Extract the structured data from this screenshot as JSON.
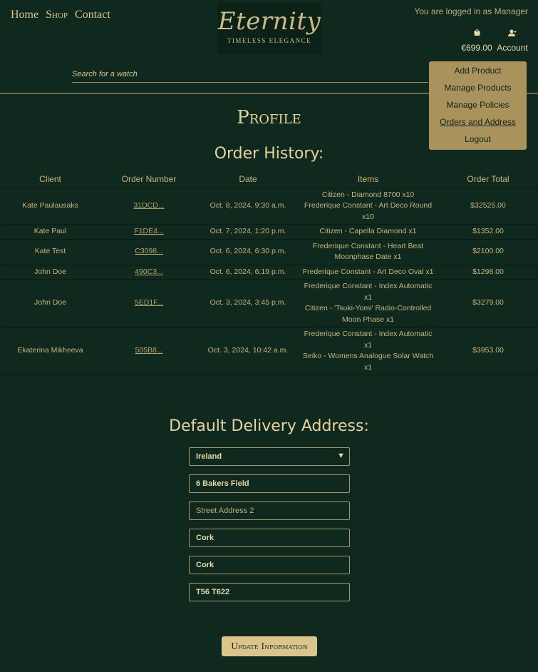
{
  "nav": {
    "home": "Home",
    "shop": "Shop",
    "contact": "Contact"
  },
  "logo": {
    "word": "Eternity",
    "tagline": "TIMELESS  ELEGANCE"
  },
  "header": {
    "logged_in": "You are logged in as Manager",
    "cart_total": "€699.00",
    "account": "Account",
    "cart_icon": "basket-icon",
    "account_icon": "user-icon"
  },
  "search": {
    "placeholder": "Search for a watch"
  },
  "dropdown": {
    "items": [
      "Add Product",
      "Manage Products",
      "Manage Policies",
      "Orders and Address",
      "Logout"
    ]
  },
  "page": {
    "title": "Profile",
    "history_title": "Order History:",
    "address_title": "Default Delivery Address:"
  },
  "orders": {
    "headers": [
      "Client",
      "Order Number",
      "Date",
      "Items",
      "Order Total"
    ],
    "rows": [
      {
        "client": "Kate Paulausaks",
        "number": "31DCD...",
        "date": "Oct. 8, 2024, 9:30 a.m.",
        "items": [
          "Citizen - Diamond 8700 x10",
          "Frederique Constant - Art Deco Round x10"
        ],
        "total": "$32525.00"
      },
      {
        "client": "Kate Paul",
        "number": "F1DE4...",
        "date": "Oct. 7, 2024, 1:20 p.m.",
        "items": [
          "Citizen - Capella Diamond x1"
        ],
        "total": "$1352.00"
      },
      {
        "client": "Kate Test",
        "number": "C3098...",
        "date": "Oct. 6, 2024, 6:30 p.m.",
        "items": [
          "Frederique Constant - Heart Beat Moonphase Date x1"
        ],
        "total": "$2100.00"
      },
      {
        "client": "John Doe",
        "number": "490C3...",
        "date": "Oct. 6, 2024, 6:19 p.m.",
        "items": [
          "Frederique Constant - Art Deco Oval x1"
        ],
        "total": "$1298.00"
      },
      {
        "client": "John Doe",
        "number": "5ED1F...",
        "date": "Oct. 3, 2024, 3:45 p.m.",
        "items": [
          "Frederique Constant - Index Automatic x1",
          "Citizen - 'Tsuki-Yomi' Radio-Controlled Moon Phase x1"
        ],
        "total": "$3279.00"
      },
      {
        "client": "Ekaterina Mikheeva",
        "number": "505B8...",
        "date": "Oct. 3, 2024, 10:42 a.m.",
        "items": [
          "Frederique Constant - Index Automatic x1",
          "Seiko - Womens Analogue Solar Watch x1"
        ],
        "total": "$3953.00"
      }
    ]
  },
  "address": {
    "country": "Ireland",
    "street1": "6 Bakers Field",
    "street2_placeholder": "Street Address 2",
    "town": "Cork",
    "county": "Cork",
    "postcode": "T56 T622",
    "update_button": "Update Information"
  },
  "colors": {
    "background": "#10291f",
    "gold": "#d8c68e",
    "dropdown": "#a9925b",
    "button": "#dcc58d"
  }
}
